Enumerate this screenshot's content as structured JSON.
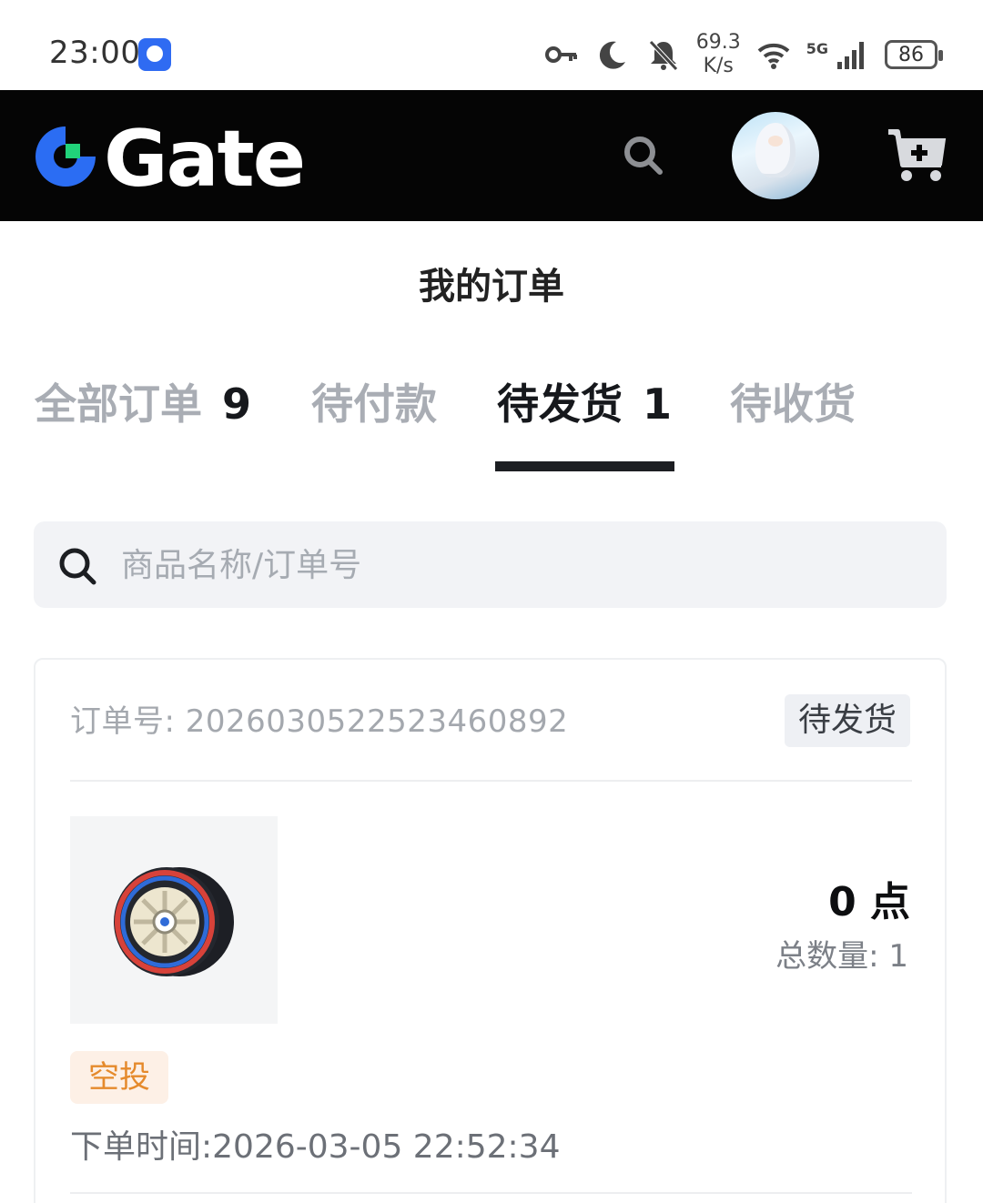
{
  "status_bar": {
    "time": "23:00",
    "net_speed_value": "69.3",
    "net_speed_unit": "K/s",
    "network": "5G",
    "battery": "86"
  },
  "header": {
    "brand": "Gate",
    "colors": {
      "background": "#050505",
      "brand_blue": "#2b6df3",
      "brand_green": "#21d37a"
    }
  },
  "page": {
    "title": "我的订单"
  },
  "tabs": [
    {
      "label": "全部订单",
      "count": "9",
      "active": false
    },
    {
      "label": "待付款",
      "count": "",
      "active": false
    },
    {
      "label": "待发货",
      "count": "1",
      "active": true
    },
    {
      "label": "待收货",
      "count": "",
      "active": false
    }
  ],
  "search": {
    "placeholder": "商品名称/订单号"
  },
  "order": {
    "number_label": "订单号: 2026030522523460892",
    "status": "待发货",
    "price": "0 点",
    "quantity": "总数量: 1",
    "tag": "空投",
    "order_time": "下单时间:2026-03-05 22:52:34",
    "tag_color": "#e58a2c"
  }
}
